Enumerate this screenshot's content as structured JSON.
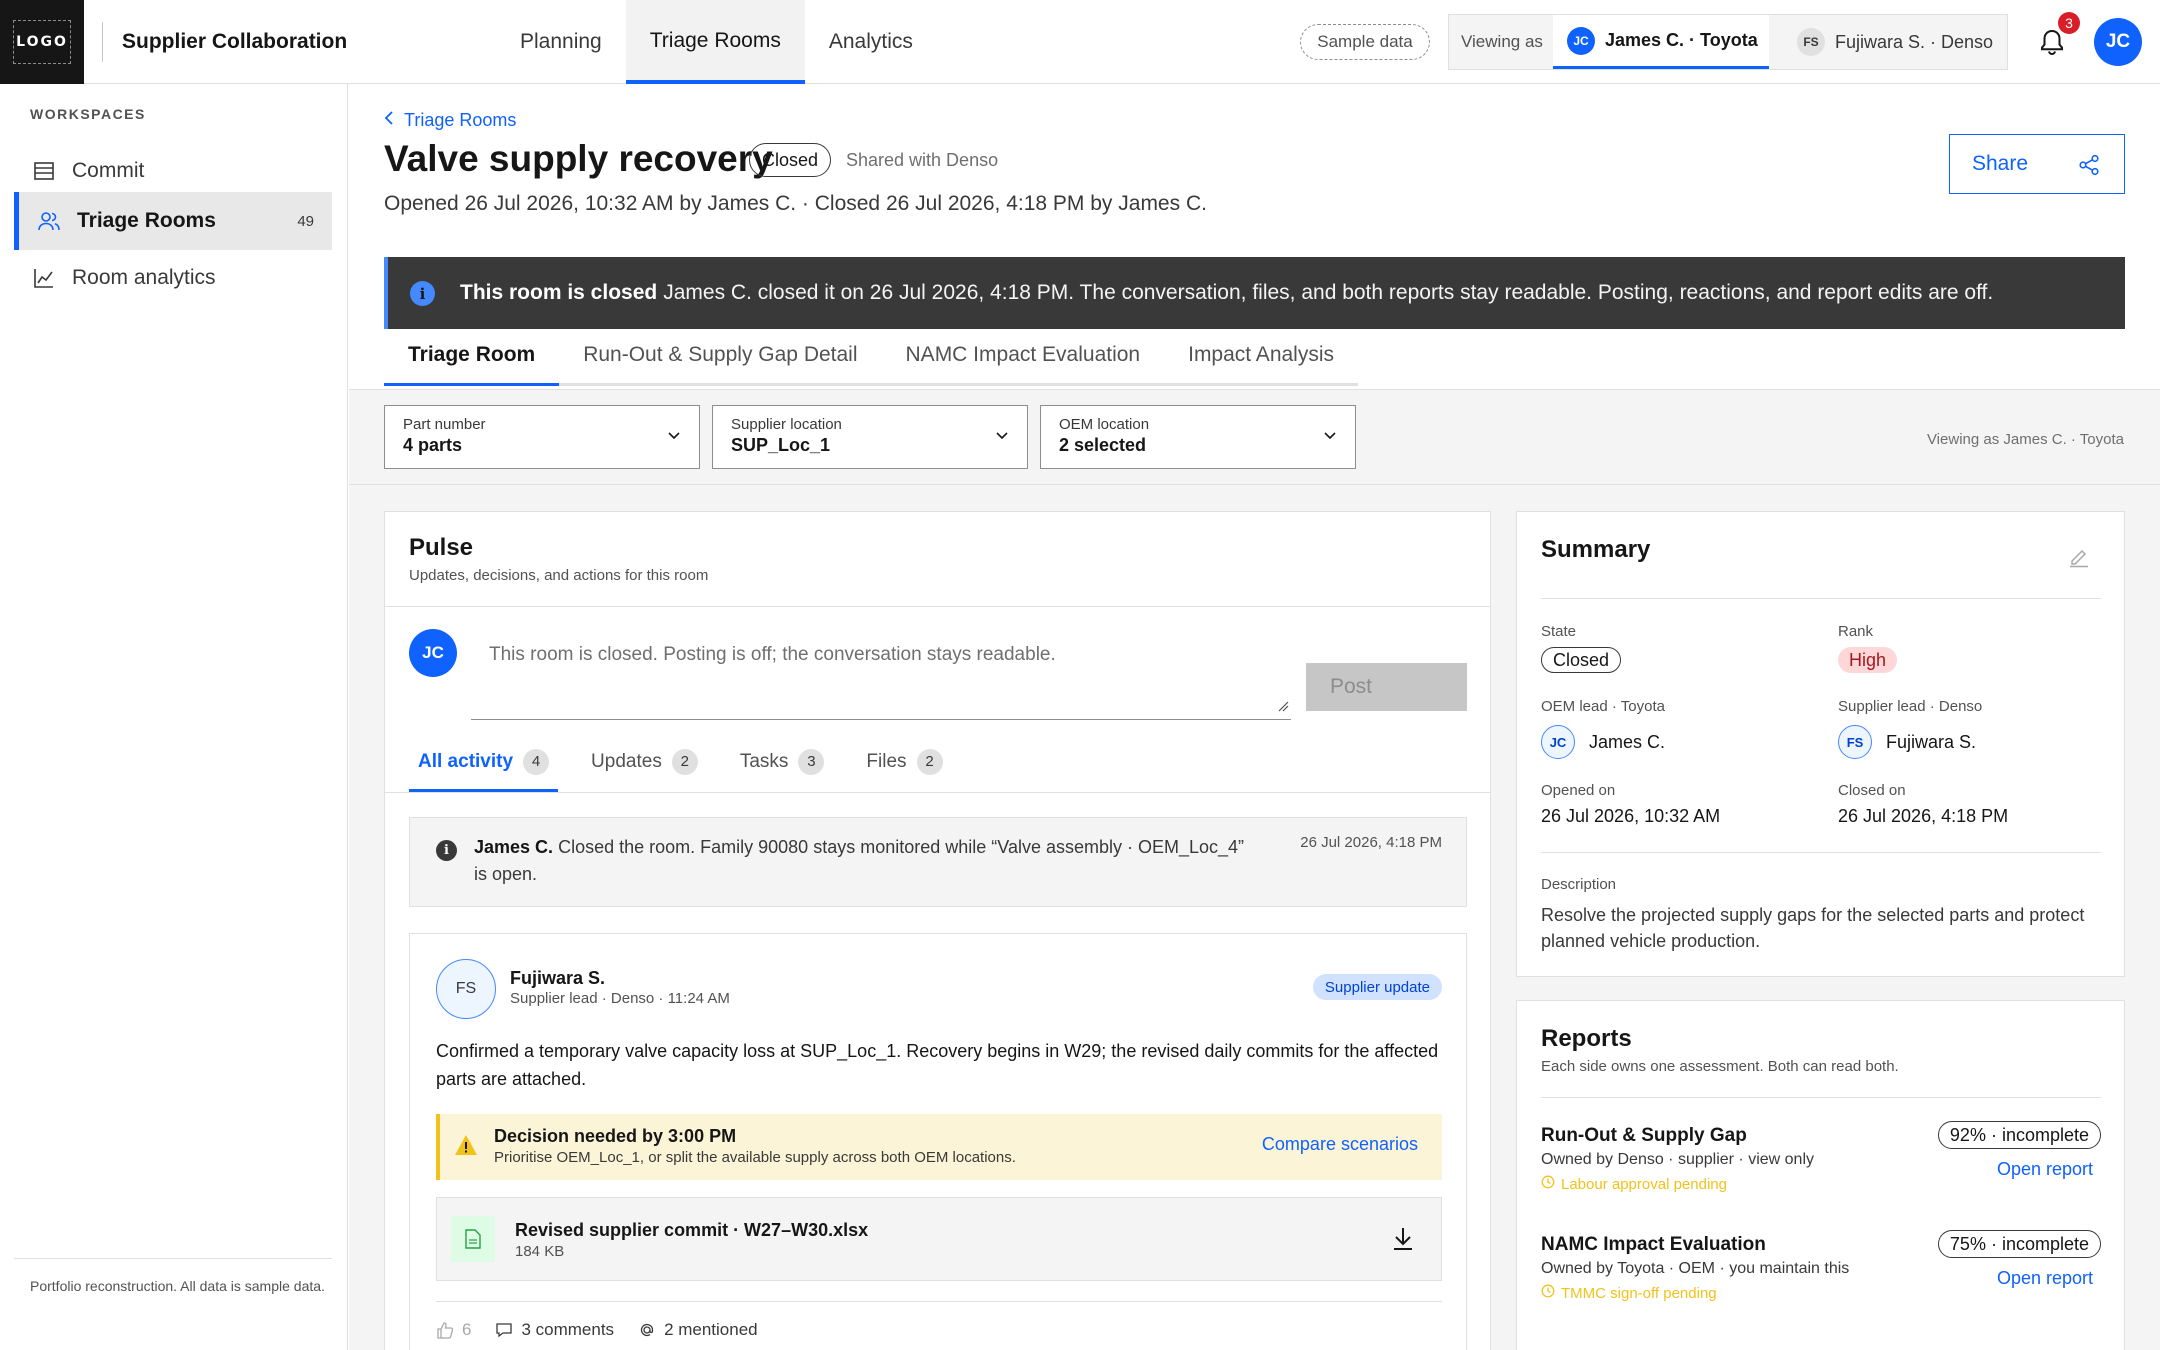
{
  "app": {
    "logo_text": "LOGO",
    "title": "Supplier Collaboration",
    "nav": [
      {
        "label": "Planning"
      },
      {
        "label": "Triage Rooms"
      },
      {
        "label": "Analytics"
      }
    ],
    "sample_data_label": "Sample data",
    "viewing_as_label": "Viewing as",
    "personas": [
      {
        "initials": "JC",
        "label": "James C. · Toyota"
      },
      {
        "initials": "FS",
        "label": "Fujiwara S. · Denso"
      }
    ],
    "notification_count": "3",
    "user_initials": "JC",
    "accent_color": "#0f62fe"
  },
  "sidebar": {
    "section_label": "WORKSPACES",
    "items": [
      {
        "label": "Commit",
        "icon": "table-icon"
      },
      {
        "label": "Triage Rooms",
        "icon": "users-icon",
        "count": "49"
      },
      {
        "label": "Room analytics",
        "icon": "chart-line-icon"
      }
    ],
    "footer": "Portfolio reconstruction. All data is sample data."
  },
  "room": {
    "breadcrumb": "Triage Rooms",
    "title": "Valve supply recovery",
    "state": "Closed",
    "shared_with": "Shared with Denso",
    "opened_line": "Opened 26 Jul 2026, 10:32 AM by James C. · Closed 26 Jul 2026, 4:18 PM by James C.",
    "share_label": "Share"
  },
  "banner": {
    "bold": "This room is closed",
    "text": "James C. closed it on 26 Jul 2026, 4:18 PM. The conversation, files, and both reports stay readable. Posting, reactions, and report edits are off."
  },
  "tabs": [
    {
      "label": "Triage Room"
    },
    {
      "label": "Run-Out & Supply Gap Detail"
    },
    {
      "label": "NAMC Impact Evaluation"
    },
    {
      "label": "Impact Analysis"
    }
  ],
  "filters": [
    {
      "label": "Part number",
      "value": "4 parts"
    },
    {
      "label": "Supplier location",
      "value": "SUP_Loc_1"
    },
    {
      "label": "OEM location",
      "value": "2 selected"
    }
  ],
  "viewing_right": "Viewing as James C. · Toyota",
  "pulse": {
    "title": "Pulse",
    "subtitle": "Updates, decisions, and actions for this room",
    "composer_initials": "JC",
    "composer_placeholder": "This room is closed. Posting is off; the conversation stays readable.",
    "post_label": "Post",
    "activity_tabs": [
      {
        "label": "All activity",
        "count": "4"
      },
      {
        "label": "Updates",
        "count": "2"
      },
      {
        "label": "Tasks",
        "count": "3"
      },
      {
        "label": "Files",
        "count": "2"
      }
    ],
    "system_note": {
      "author": "James C.",
      "text": "Closed the room. Family 90080 stays monitored while “Valve assembly · OEM_Loc_4” is open.",
      "time": "26 Jul 2026, 4:18 PM"
    },
    "post": {
      "initials": "FS",
      "author": "Fujiwara S.",
      "meta": "Supplier lead · Denso · 11:24 AM",
      "tag": "Supplier update",
      "body": "Confirmed a temporary valve capacity loss at SUP_Loc_1. Recovery begins in W29; the revised daily commits for the affected parts are attached.",
      "decision_title": "Decision needed by 3:00 PM",
      "decision_sub": "Prioritise OEM_Loc_1, or split the available supply across both OEM locations.",
      "decision_link": "Compare scenarios",
      "file_name": "Revised supplier commit · W27–W30.xlsx",
      "file_size": "184 KB",
      "likes": "6",
      "comments": "3 comments",
      "mentions": "2 mentioned"
    }
  },
  "summary": {
    "title": "Summary",
    "state_label": "State",
    "state_value": "Closed",
    "rank_label": "Rank",
    "rank_value": "High",
    "oem_lead_label": "OEM lead · Toyota",
    "oem_lead_initials": "JC",
    "oem_lead_name": "James C.",
    "supplier_lead_label": "Supplier lead · Denso",
    "supplier_lead_initials": "FS",
    "supplier_lead_name": "Fujiwara S.",
    "opened_label": "Opened on",
    "opened_value": "26 Jul 2026, 10:32 AM",
    "closed_label": "Closed on",
    "closed_value": "26 Jul 2026, 4:18 PM",
    "description_label": "Description",
    "description": "Resolve the projected supply gaps for the selected parts and protect planned vehicle production."
  },
  "reports": {
    "title": "Reports",
    "subtitle": "Each side owns one assessment. Both can read both.",
    "items": [
      {
        "name": "Run-Out & Supply Gap",
        "owner": "Owned by Denso · supplier · view only",
        "pending": "Labour approval pending",
        "status": "92% · incomplete",
        "open": "Open report"
      },
      {
        "name": "NAMC Impact Evaluation",
        "owner": "Owned by Toyota · OEM · you maintain this",
        "pending": "TMMC sign-off pending",
        "status": "75% · incomplete",
        "open": "Open report"
      }
    ]
  }
}
